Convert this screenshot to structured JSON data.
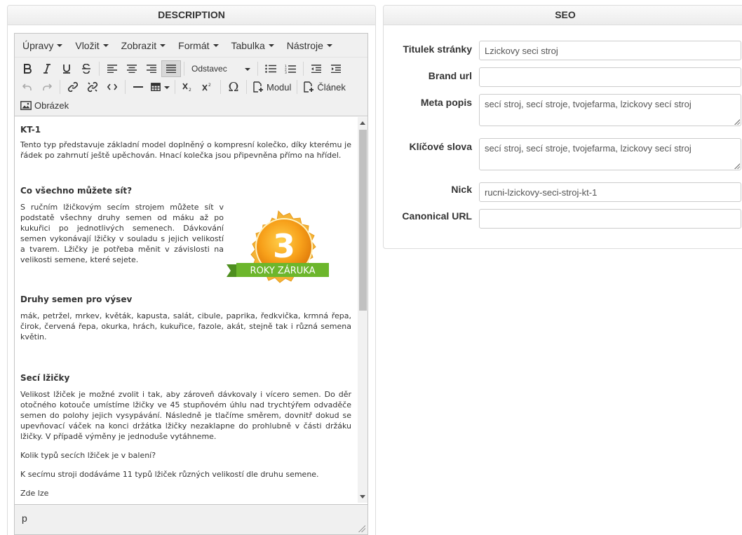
{
  "description_panel": {
    "title": "DESCRIPTION"
  },
  "seo_panel": {
    "title": "SEO"
  },
  "menu": [
    "Úpravy",
    "Vložit",
    "Zobrazit",
    "Formát",
    "Tabulka",
    "Nástroje"
  ],
  "toolbar": {
    "block_format": "Odstavec",
    "module_label": "Modul",
    "article_label": "Článek",
    "image_label": "Obrázek"
  },
  "content": {
    "heading1": "KT-1",
    "para1": "Tento typ představuje základní model doplněný o kompresní kolečko, díky kterému je řádek po zahrnutí ještě upěchován. Hnací kolečka jsou připevněna přímo na hřídel.",
    "heading2": "Co všechno můžete sít?",
    "para2": "S ručním lžičkovým secím strojem můžete sít v podstatě všechny druhy semen od máku až po kukuřici po jednotlivých semenech. Dávkování semen vykonávají lžičky v souladu s jejich velikostí a tvarem. Lžičky je potřeba měnit v závislosti na velikosti semene, které sejete.",
    "heading3": "Druhy semen pro výsev",
    "para3": "mák, petržel, mrkev, květák, kapusta, salát, cibule, paprika, ředkvička, krmná řepa, čirok, červená řepa, okurka, hrách, kukuřice, fazole, akát, stejně tak i různá semena květin.",
    "heading4": "Secí lžičky",
    "para4": "Velikost lžiček je možné zvolit i tak, aby zároveň dávkovaly i vícero semen. Do děr otočného kotouče umístíme lžičky ve 45 stupňovém úhlu nad trychtýřem odvaděče semen do polohy jejich vysypávání. Následně je tlačíme směrem, dovnitř dokud se upevňovací váček na konci držátka lžičky nezaklapne do prohlubně v části držáku lžičky. V případě výměny je jednoduše vytáhneme.",
    "para5": "Kolik typů secích lžiček je v balení?",
    "para6": "K secímu stroji dodáváme 11 typů lžiček různých velikostí dle druhu semene.",
    "para7": "Zde lze"
  },
  "badge": {
    "number": "3",
    "text": "ROKY ZÁRUKA"
  },
  "status_path": "p",
  "seo": {
    "title_label": "Titulek stránky",
    "title_value": "Lzickovy seci stroj",
    "brand_label": "Brand url",
    "brand_value": "",
    "meta_label": "Meta popis",
    "meta_value": "secí stroj, secí stroje, tvojefarma, lzickovy secí stroj",
    "keywords_label": "Klíčové slova",
    "keywords_value": "secí stroj, secí stroje, tvojefarma, lzickovy secí stroj",
    "nick_label": "Nick",
    "nick_value": "rucni-lzickovy-seci-stroj-kt-1",
    "canonical_label": "Canonical URL",
    "canonical_value": ""
  }
}
